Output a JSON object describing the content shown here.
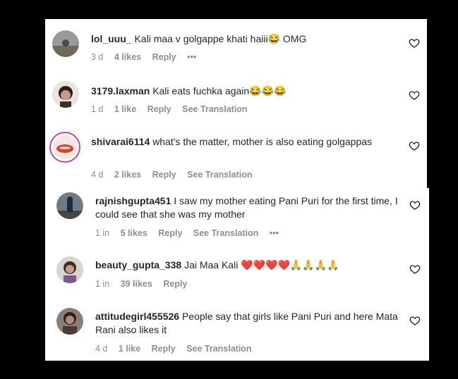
{
  "comments": [
    {
      "username": "lol_uuu_",
      "text": "Kali maa v golgappe khati haiii😂 OMG",
      "age": "3 d",
      "likes": "4 likes",
      "reply": "Reply",
      "translate": "",
      "more": "•••"
    },
    {
      "username": "3179.laxman",
      "text": "Kali eats fuchka again😂😂😂",
      "age": "1 d",
      "likes": "1 like",
      "reply": "Reply",
      "translate": "See Translation",
      "more": ""
    },
    {
      "username": "shivarai6114",
      "text": "what's the matter, mother is also eating golgappas",
      "age": "4 d",
      "likes": "2 likes",
      "reply": "Reply",
      "translate": "See Translation",
      "more": ""
    },
    {
      "username": "rajnishgupta451",
      "text": "I saw my mother eating Pani Puri for the first time, I could see that she was my mother",
      "age": "1 in",
      "likes": "5 likes",
      "reply": "Reply",
      "translate": "See Translation",
      "more": "•••"
    },
    {
      "username": "beauty_gupta_338",
      "text": "Jai Maa Kali ❤️❤️❤️❤️🙏🙏🙏🙏",
      "age": "1 in",
      "likes": "39 likes",
      "reply": "Reply",
      "translate": "",
      "more": ""
    },
    {
      "username": "attitudegirl455526",
      "text": "People say that girls like Pani Puri and here Mata Rani also likes it",
      "age": "4 d",
      "likes": "1 like",
      "reply": "Reply",
      "translate": "See Translation",
      "more": ""
    }
  ],
  "icons": {
    "like": "heart-outline-icon"
  }
}
